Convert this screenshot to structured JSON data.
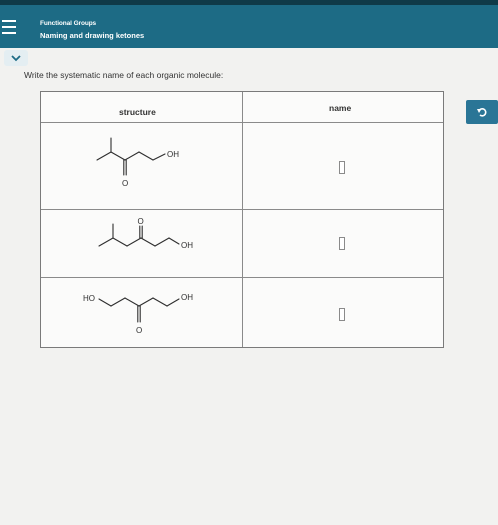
{
  "header": {
    "title": "Functional Groups",
    "subtitle": "Naming and drawing ketones"
  },
  "instructions": "Write the systematic name of each organic molecule:",
  "table": {
    "headers": {
      "structure": "structure",
      "name": "name"
    },
    "rows": [
      {
        "labels": {
          "oh": "OH",
          "o": "O"
        },
        "name_value": ""
      },
      {
        "labels": {
          "oh": "OH",
          "o": "O"
        },
        "name_value": ""
      },
      {
        "labels": {
          "ho": "HO",
          "oh": "OH",
          "o": "O"
        },
        "name_value": ""
      }
    ]
  },
  "icons": {
    "menu": "hamburger-menu-icon",
    "collapse": "chevron-down-icon",
    "redo": "undo-arrow-icon"
  },
  "colors": {
    "header_bg": "#1d6b85",
    "button_bg": "#2a7596",
    "page_bg": "#f2f2f0"
  }
}
